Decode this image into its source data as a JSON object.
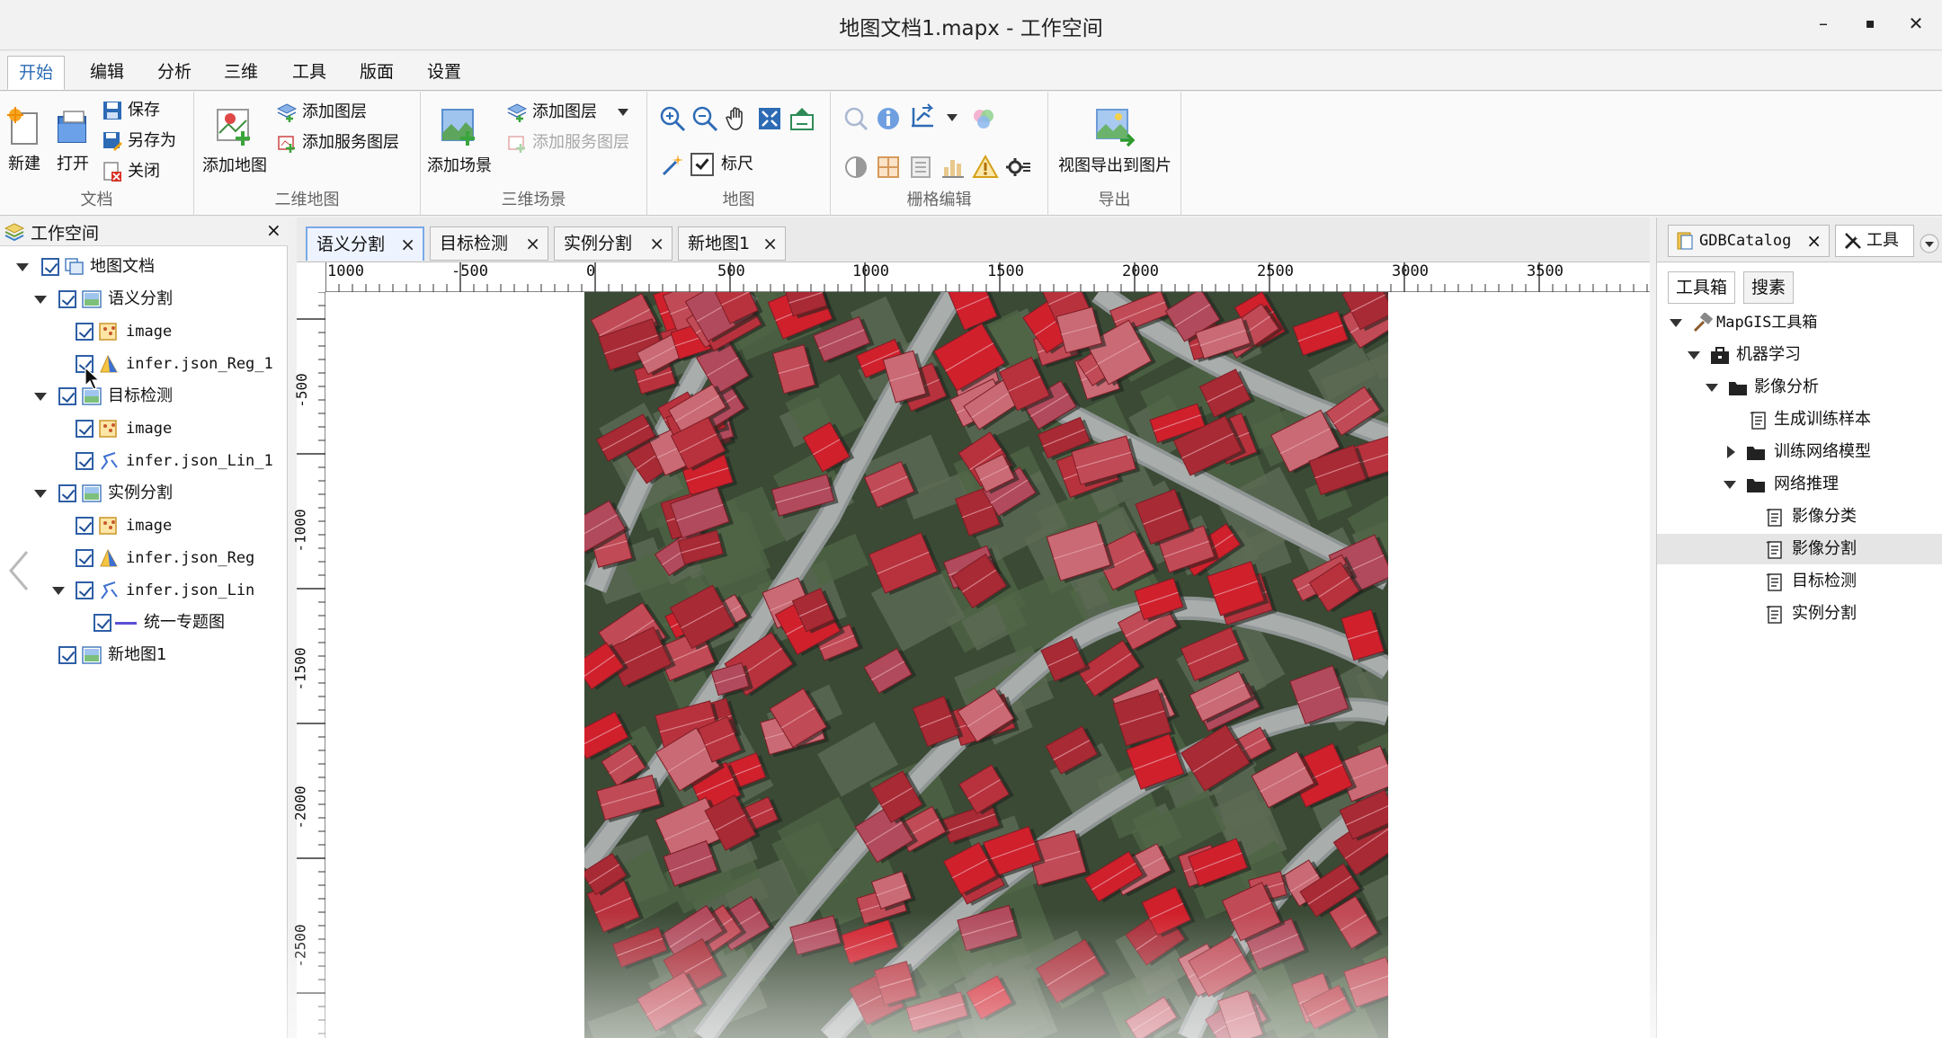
{
  "window": {
    "title": "地图文档1.mapx - 工作空间",
    "minimize_label": "–",
    "maximize_label": "▪",
    "close_label": "✕"
  },
  "menu_tabs": [
    {
      "label": "开始",
      "active": true
    },
    {
      "label": "编辑"
    },
    {
      "label": "分析"
    },
    {
      "label": "三维"
    },
    {
      "label": "工具"
    },
    {
      "label": "版面"
    },
    {
      "label": "设置"
    }
  ],
  "ribbon": {
    "doc_group": {
      "label": "文档",
      "new_label": "新建",
      "open_label": "打开",
      "save_label": "保存",
      "saveas_label": "另存为",
      "close_label": "关闭"
    },
    "map2d_group": {
      "label": "二维地图",
      "add_map_label": "添加地图",
      "add_layer_label": "添加图层",
      "add_service_layer_label": "添加服务图层"
    },
    "scene3d_group": {
      "label": "三维场景",
      "add_scene_label": "添加场景",
      "add_layer_label": "添加图层",
      "add_service_layer_label": "添加服务图层"
    },
    "map_group": {
      "label": "地图",
      "ruler_label": "标尺"
    },
    "raster_group": {
      "label": "栅格编辑"
    },
    "export_group": {
      "label": "导出",
      "export_label": "视图导出到图片"
    }
  },
  "workspace": {
    "title": "工作空间",
    "close_label": "×",
    "tree": {
      "root": "地图文档",
      "map1": "语义分割",
      "map1_layer1": "image",
      "map1_layer2": "infer.json_Reg_1",
      "map2": "目标检测",
      "map2_layer1": "image",
      "map2_layer2": "infer.json_Lin_1",
      "map3": "实例分割",
      "map3_layer1": "image",
      "map3_layer2": "infer.json_Reg",
      "map3_layer3": "infer.json_Lin",
      "map3_layer3_child": "统一专题图",
      "map4": "新地图1"
    }
  },
  "doc_tabs": [
    {
      "label": "语义分割",
      "active": true
    },
    {
      "label": "目标检测"
    },
    {
      "label": "实例分割"
    },
    {
      "label": "新地图1"
    }
  ],
  "rulers": {
    "h_labels": [
      "1000",
      "-500",
      "0",
      "500",
      "1000",
      "1500",
      "2000",
      "2500",
      "3000",
      "3500"
    ],
    "v_labels": [
      "-500",
      "-1000",
      "-1500",
      "-2000",
      "-2500"
    ]
  },
  "right_panel": {
    "tab1_label": "GDBCatalog",
    "tab2_label": "工具",
    "subtab1_label": "工具箱",
    "subtab2_label": "搜素",
    "tree": {
      "root": "MapGIS工具箱",
      "ml": "机器学习",
      "img_analysis": "影像分析",
      "gen_samples": "生成训练样本",
      "train_model": "训练网络模型",
      "inference": "网络推理",
      "classify": "影像分类",
      "segment": "影像分割",
      "detect": "目标检测",
      "instance": "实例分割"
    }
  },
  "colors": {
    "accent": "#2d6bb5",
    "checkbox": "#2f5fa6",
    "roof_red": "#b8323d",
    "selected_row": "#e5e5e5"
  }
}
